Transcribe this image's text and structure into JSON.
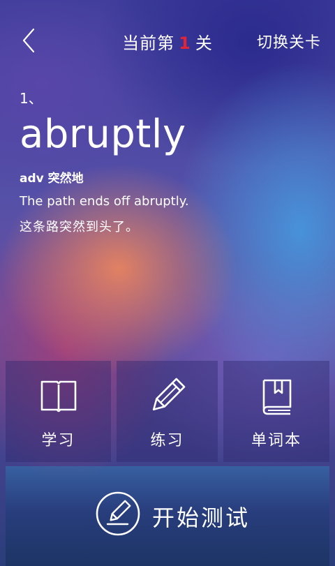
{
  "header": {
    "title_prefix": "当前第",
    "level_number": "1",
    "title_suffix": "关",
    "switch_label": "切换关卡",
    "back_icon": "chevron-left-icon"
  },
  "word_card": {
    "index": "1、",
    "word": "abruptly",
    "pos_meaning": "adv 突然地",
    "example_en": "The path ends off abruptly.",
    "example_zh": "这条路突然到头了。"
  },
  "actions": [
    {
      "label": "学习",
      "icon": "open-book-icon"
    },
    {
      "label": "练习",
      "icon": "pencil-icon"
    },
    {
      "label": "单词本",
      "icon": "bookmarked-book-icon"
    }
  ],
  "start_button": {
    "label": "开始测试",
    "icon": "edit-circle-icon"
  },
  "colors": {
    "level_number": "#e0243a",
    "text": "#ffffff"
  }
}
